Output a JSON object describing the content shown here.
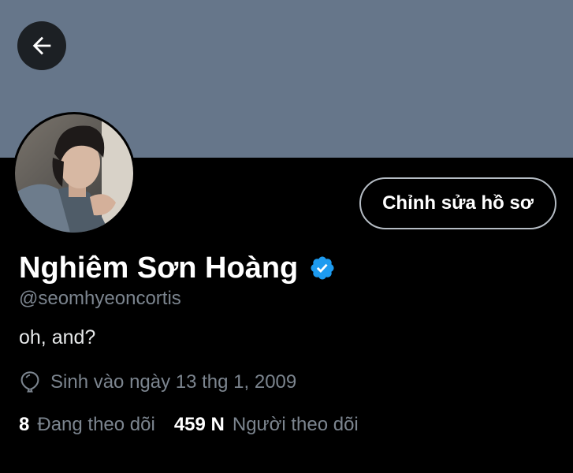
{
  "header": {
    "banner_color": "#66768a",
    "back_button_icon": "arrow-left-icon"
  },
  "profile": {
    "avatar_alt": "profile photo",
    "edit_button_label": "Chỉnh sửa hồ sơ",
    "display_name": "Nghiêm Sơn Hoàng",
    "verified_icon": "verified-badge-icon",
    "verified_color": "#1d9bf0",
    "handle": "@seomhyeoncortis",
    "bio": "oh, and?",
    "birth_icon": "balloon-icon",
    "birth_text": "Sinh vào ngày 13 thg 1, 2009"
  },
  "stats": {
    "following_count": "8",
    "following_label": "Đang theo dõi",
    "followers_count": "459 N",
    "followers_label": "Người theo dõi"
  }
}
